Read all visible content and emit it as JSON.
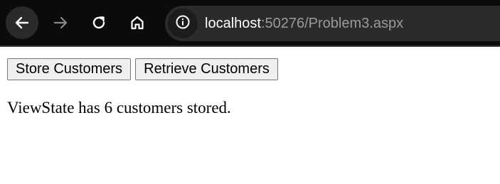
{
  "browser": {
    "url_host": "localhost",
    "url_rest": ":50276/Problem3.aspx",
    "icons": [
      "back-arrow-icon",
      "forward-arrow-icon",
      "reload-icon",
      "home-icon",
      "info-icon"
    ],
    "colors": {
      "toolbar_bg": "#0b0b0b",
      "address_bar_bg": "#2b2b2b",
      "url_host": "#ffffff",
      "url_rest": "#9a9a9a"
    }
  },
  "page": {
    "store_button": "Store Customers",
    "retrieve_button": "Retrieve Customers",
    "status_message": "ViewState has 6 customers stored."
  }
}
